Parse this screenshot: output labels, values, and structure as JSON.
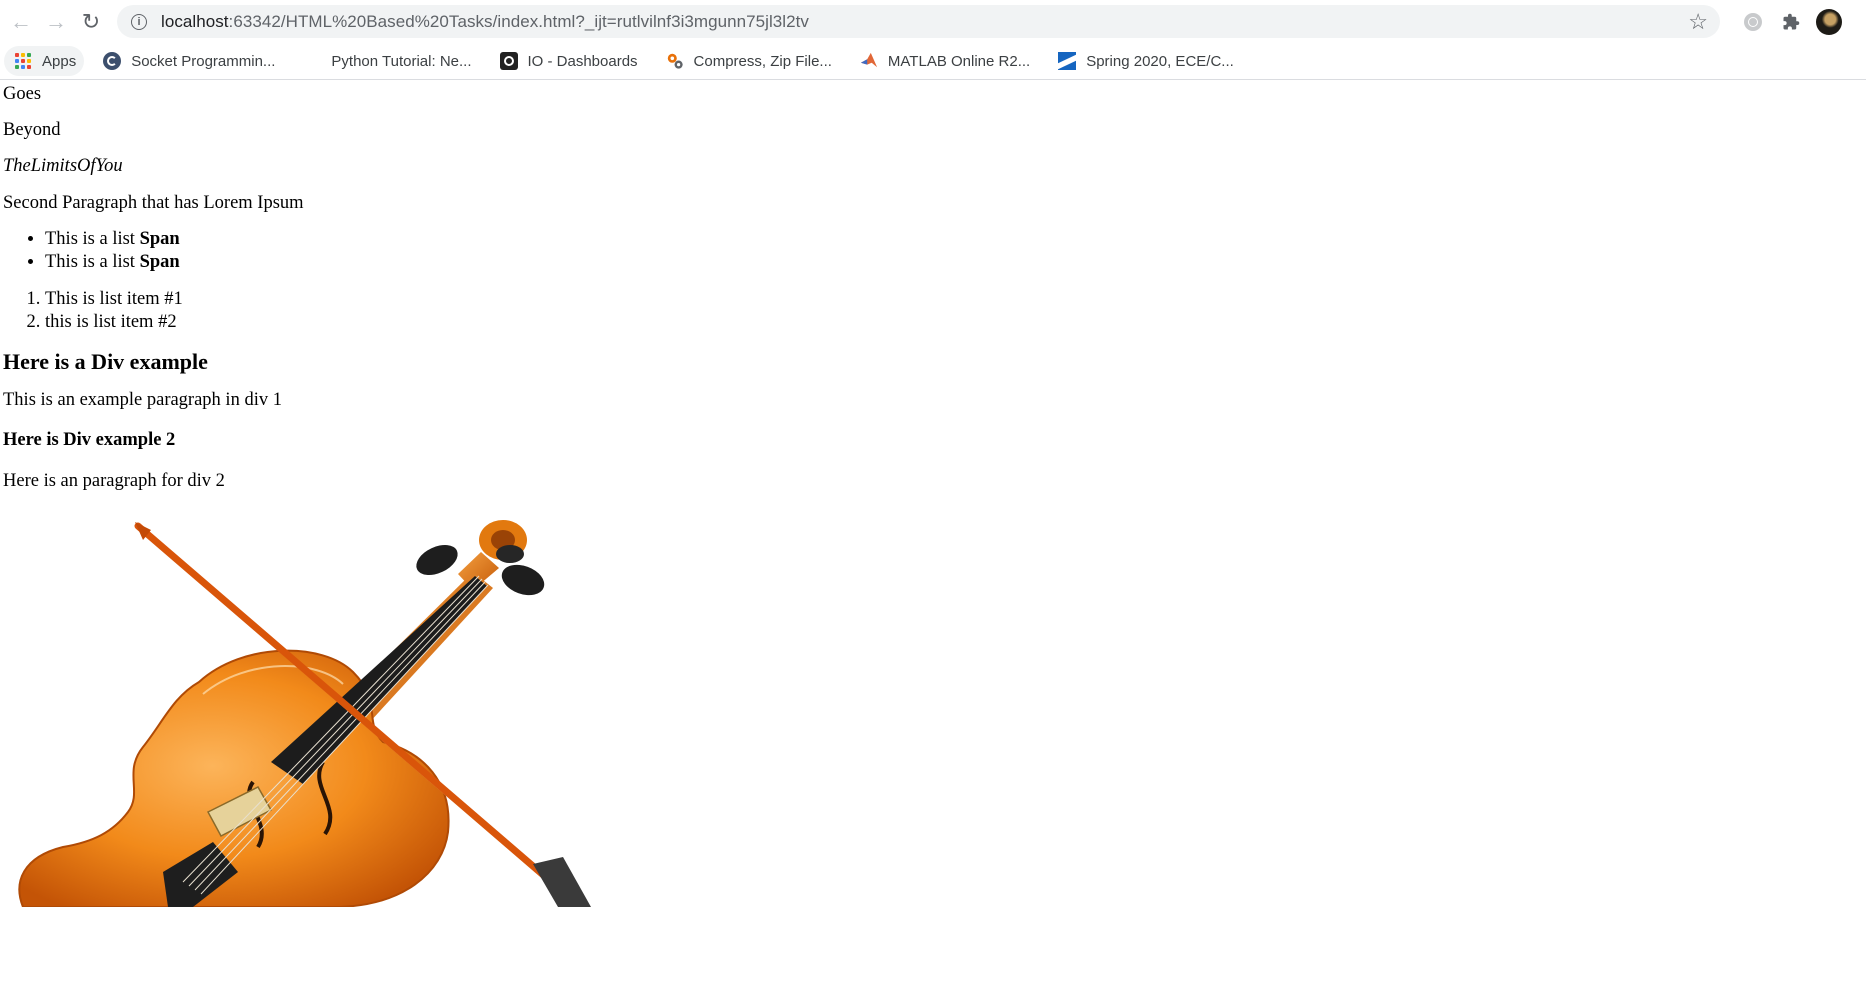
{
  "browser": {
    "url_host": "localhost",
    "url_rest": ":63342/HTML%20Based%20Tasks/index.html?_ijt=rutlvilnf3i3mgunn75jl3l2tv",
    "bookmarks": [
      {
        "label": "Apps",
        "icon": "apps-grid-icon"
      },
      {
        "label": "Socket Programmin...",
        "icon": "socket-icon"
      },
      {
        "label": "Python Tutorial: Ne...",
        "icon": "blank-page-icon"
      },
      {
        "label": "IO - Dashboards",
        "icon": "io-icon"
      },
      {
        "label": "Compress, Zip File...",
        "icon": "gears-icon"
      },
      {
        "label": "MATLAB Online R2...",
        "icon": "matlab-icon"
      },
      {
        "label": "Spring 2020, ECE/C...",
        "icon": "spring-icon"
      }
    ]
  },
  "page": {
    "line1": "Goes",
    "line2": "Beyond",
    "line3": "TheLimitsOfYou",
    "line4": "Second Paragraph that has Lorem Ipsum",
    "ul_items": [
      {
        "text": "This is a list ",
        "bold": "Span"
      },
      {
        "text": "This is a list ",
        "bold": "Span"
      }
    ],
    "ol_items": [
      "This is list item #1",
      "this is list item #2"
    ],
    "div1_heading": "Here is a Div example",
    "div1_paragraph": "This is an example paragraph in div 1",
    "div2_heading": "Here is Div example 2",
    "div2_paragraph": "Here is an paragraph for div 2"
  },
  "colors": {
    "violin_body": "#f07d0c",
    "violin_highlight": "#fbb355",
    "fingerboard": "#1c1c1c",
    "bow_stick": "#d9550a"
  }
}
